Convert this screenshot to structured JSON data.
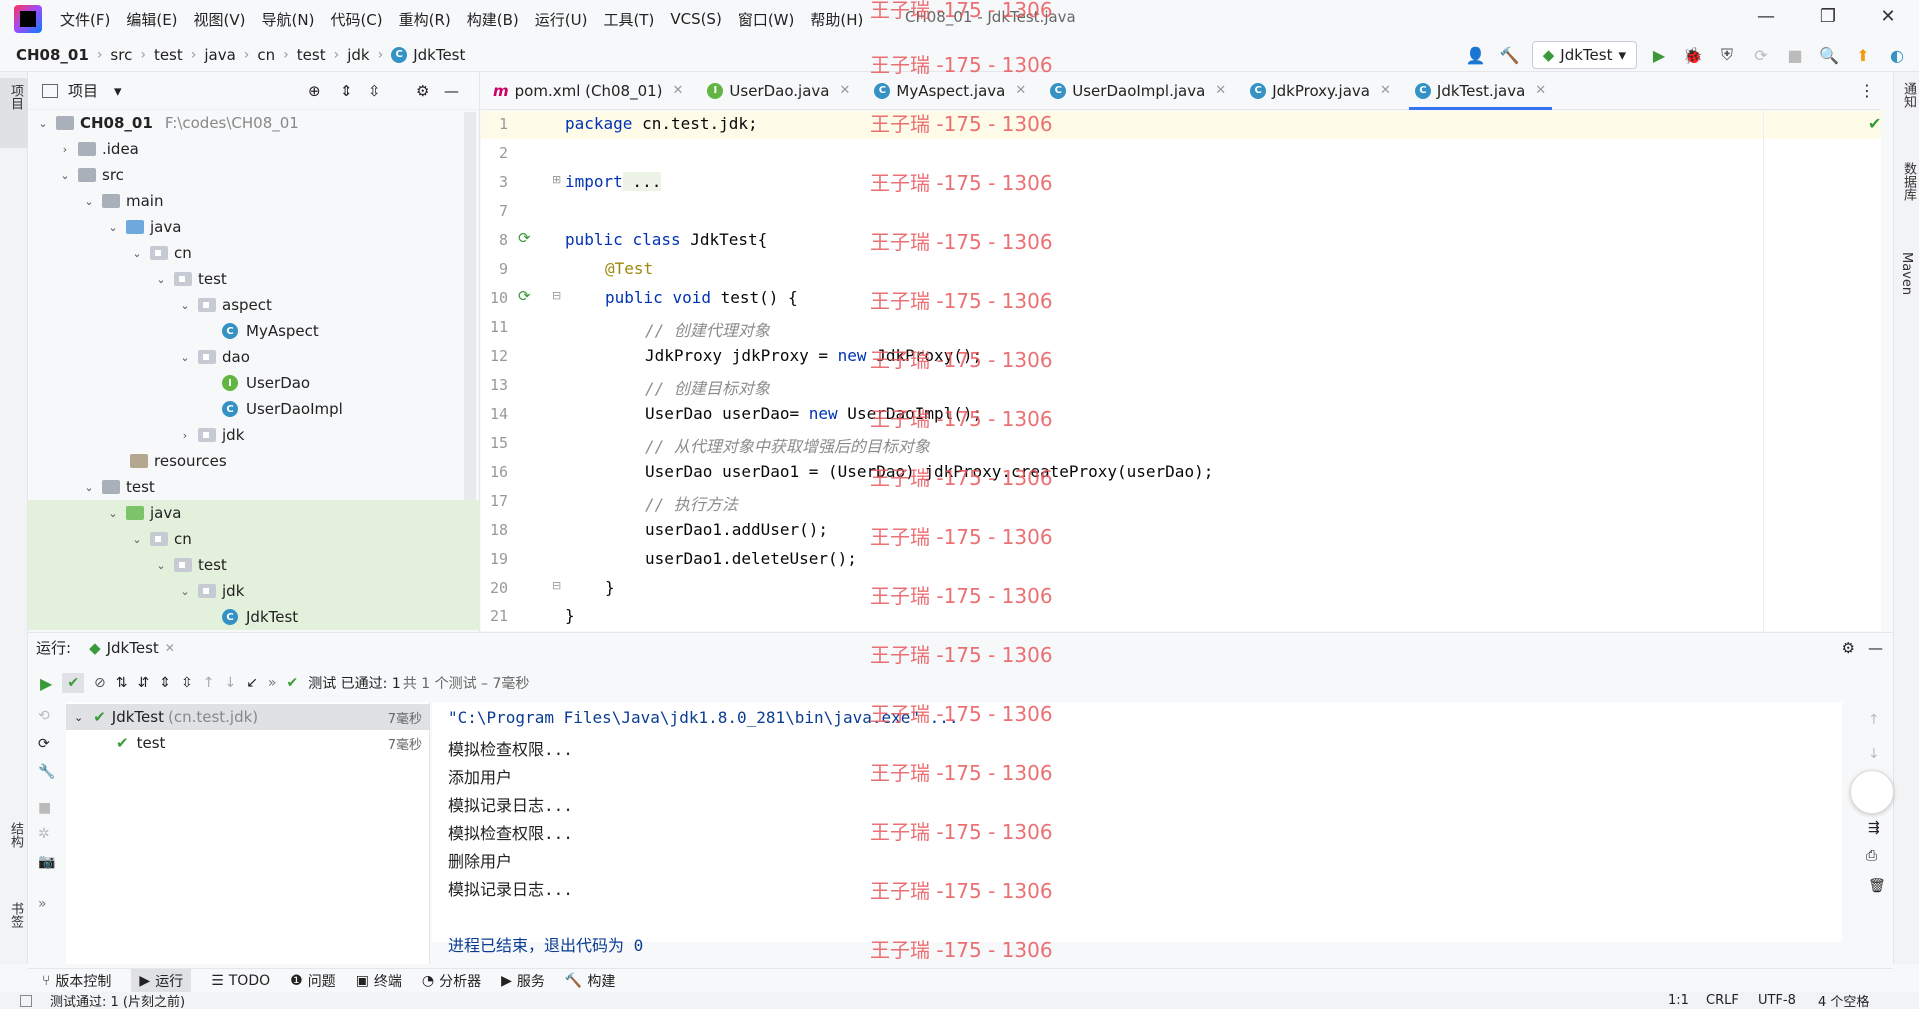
{
  "window": {
    "title": "CH08_01 - JdkTest.java",
    "menu": [
      "文件(F)",
      "编辑(E)",
      "视图(V)",
      "导航(N)",
      "代码(C)",
      "重构(R)",
      "构建(B)",
      "运行(U)",
      "工具(T)",
      "VCS(S)",
      "窗口(W)",
      "帮助(H)"
    ]
  },
  "breadcrumb": [
    "CH08_01",
    "src",
    "test",
    "java",
    "cn",
    "test",
    "jdk",
    "JdkTest"
  ],
  "toolbar": {
    "run_config": "JdkTest"
  },
  "left_strip": {
    "project": "项目",
    "structure": "结构",
    "bookmarks": "书签"
  },
  "right_strip": {
    "notifications": "通知",
    "database": "数据库",
    "maven": "Maven"
  },
  "project": {
    "header": "项目",
    "tree": [
      {
        "label": "CH08_01",
        "path": "F:\\codes\\CH08_01"
      },
      {
        "label": ".idea"
      },
      {
        "label": "src"
      },
      {
        "label": "main"
      },
      {
        "label": "java"
      },
      {
        "label": "cn"
      },
      {
        "label": "test"
      },
      {
        "label": "aspect"
      },
      {
        "label": "MyAspect"
      },
      {
        "label": "dao"
      },
      {
        "label": "UserDao"
      },
      {
        "label": "UserDaoImpl"
      },
      {
        "label": "jdk"
      },
      {
        "label": "resources"
      },
      {
        "label": "test"
      },
      {
        "label": "java"
      },
      {
        "label": "cn"
      },
      {
        "label": "test"
      },
      {
        "label": "jdk"
      },
      {
        "label": "JdkTest"
      }
    ]
  },
  "tabs": [
    "pom.xml (Ch08_01)",
    "UserDao.java",
    "MyAspect.java",
    "UserDaoImpl.java",
    "JdkProxy.java",
    "JdkTest.java"
  ],
  "editor": {
    "line_numbers": [
      "1",
      "2",
      "3",
      "7",
      "8",
      "9",
      "10",
      "11",
      "12",
      "13",
      "14",
      "15",
      "16",
      "17",
      "18",
      "19",
      "20",
      "21"
    ],
    "lines": {
      "l1_kw": "package",
      "l1_rest": " cn.test.jdk;",
      "l3_kw": "import",
      "l3_rest": " ...",
      "l8_kw1": "public",
      "l8_kw2": "class",
      "l8_rest": " JdkTest{",
      "l9": "@Test",
      "l10_kw1": "public",
      "l10_kw2": "void",
      "l10_rest": " test() {",
      "l11": "// 创建代理对象",
      "l12_a": "JdkProxy jdkProxy = ",
      "l12_kw": "new",
      "l12_b": " JdkProxy();",
      "l13": "// 创建目标对象",
      "l14_a": "UserDao userDao= ",
      "l14_kw": "new",
      "l14_b": " UserDaoImpl();",
      "l15": "// 从代理对象中获取增强后的目标对象",
      "l16": "UserDao userDao1 = (UserDao) jdkProxy.createProxy(userDao);",
      "l17": "// 执行方法",
      "l18": "userDao1.addUser();",
      "l19": "userDao1.deleteUser();",
      "l20": "}",
      "l21": "}"
    }
  },
  "watermark": "王子瑞 -175 - 1306",
  "run": {
    "label": "运行:",
    "tab": "JdkTest",
    "status_passed": "测试 已通过: 1",
    "status_total": "共 1 个测试 – 7毫秒",
    "tree": [
      {
        "name": "JdkTest",
        "pkg": "(cn.test.jdk)",
        "time": "7毫秒"
      },
      {
        "name": "test",
        "time": "7毫秒"
      }
    ],
    "console": [
      "\"C:\\Program Files\\Java\\jdk1.8.0_281\\bin\\java.exe\" ...",
      "模拟检查权限...",
      "添加用户",
      "模拟记录日志...",
      "模拟检查权限...",
      "删除用户",
      "模拟记录日志...",
      "",
      "进程已结束，退出代码为 0"
    ]
  },
  "bottom_tools": [
    "版本控制",
    "运行",
    "TODO",
    "问题",
    "终端",
    "分析器",
    "服务",
    "构建"
  ],
  "status": {
    "message": "测试通过: 1 (片刻之前)",
    "position": "1:1",
    "line_sep": "CRLF",
    "encoding": "UTF-8",
    "indent": "4 个空格"
  }
}
